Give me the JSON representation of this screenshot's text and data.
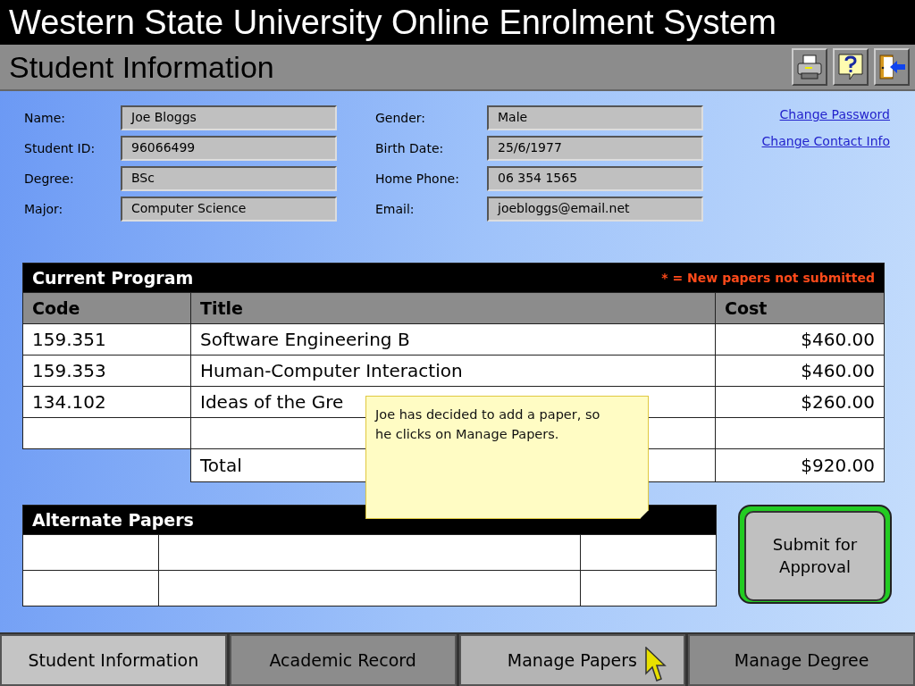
{
  "window": {
    "title": "Western State University Online Enrolment System"
  },
  "page": {
    "title": "Student Information"
  },
  "toolbar": [
    {
      "kind": "print"
    },
    {
      "kind": "help"
    },
    {
      "kind": "exit"
    }
  ],
  "student": {
    "fields_left": [
      {
        "label": "Name:",
        "value": "Joe Bloggs"
      },
      {
        "label": "Student ID:",
        "value": "96066499"
      },
      {
        "label": "Degree:",
        "value": "BSc"
      },
      {
        "label": "Major:",
        "value": "Computer Science"
      }
    ],
    "fields_right": [
      {
        "label": "Gender:",
        "value": "Male"
      },
      {
        "label": "Birth Date:",
        "value": "25/6/1977"
      },
      {
        "label": "Home Phone:",
        "value": "06 354 1565"
      },
      {
        "label": "Email:",
        "value": "joebloggs@email.net"
      }
    ],
    "links": [
      "Change Password",
      "Change Contact Info"
    ]
  },
  "current_program": {
    "title": "Current Program",
    "legend": "* = New papers not submitted",
    "columns": [
      "Code",
      "Title",
      "Cost"
    ],
    "rows": [
      {
        "kind": "paper",
        "code": "159.351",
        "title": "Software Engineering B",
        "cost": "$460.00"
      },
      {
        "kind": "paper",
        "code": "159.353",
        "title": "Human-Computer Interaction",
        "cost": "$460.00"
      },
      {
        "kind": "paper",
        "code": "134.102",
        "title": "Ideas of the Gre",
        "cost": "$260.00"
      },
      {
        "kind": "blank"
      }
    ],
    "total": {
      "label": "Total",
      "value": "$920.00"
    }
  },
  "alternate_papers": {
    "title": "Alternate Papers",
    "rows": [
      {
        "kind": "blank"
      },
      {
        "kind": "blank"
      }
    ]
  },
  "submit_button": "Submit for Approval",
  "note": {
    "text": "Joe has decided to add a paper, so he clicks on Manage Papers."
  },
  "nav_tabs": [
    {
      "label": "Student Information",
      "selected": true,
      "hovered": false
    },
    {
      "label": "Academic Record",
      "selected": false,
      "hovered": false
    },
    {
      "label": "Manage Papers",
      "selected": false,
      "hovered": true
    },
    {
      "label": "Manage Degree",
      "selected": false,
      "hovered": false
    }
  ]
}
